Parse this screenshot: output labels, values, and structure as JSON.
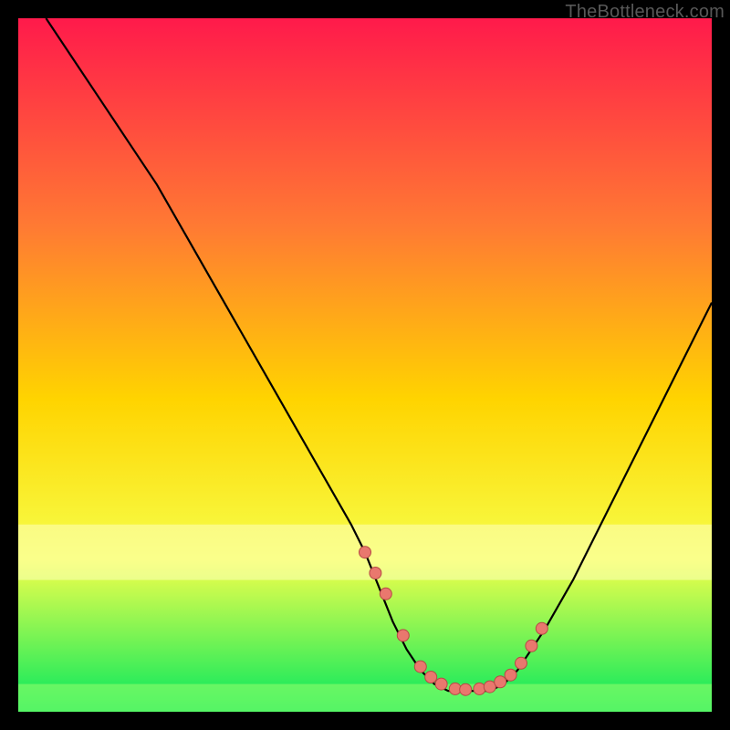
{
  "watermark": "TheBottleneck.com",
  "colors": {
    "bg": "#000000",
    "grad_top": "#ff1a4b",
    "grad_mid1": "#ff7a33",
    "grad_mid2": "#ffd400",
    "grad_mid3": "#f6ff4a",
    "grad_bottom": "#00e85e",
    "line": "#000000",
    "band_light": "#fdffc0",
    "band_green": "#9aff6b",
    "dot_fill": "#e9786e",
    "dot_stroke": "#b64a45"
  },
  "chart_data": {
    "type": "line",
    "title": "",
    "xlabel": "",
    "ylabel": "",
    "xlim": [
      0,
      100
    ],
    "ylim": [
      0,
      100
    ],
    "series": [
      {
        "name": "bottleneck-curve",
        "x": [
          4,
          8,
          12,
          16,
          20,
          24,
          28,
          32,
          36,
          40,
          44,
          48,
          50,
          52,
          54,
          56,
          58,
          60,
          62,
          64,
          66,
          68,
          70,
          72,
          76,
          80,
          84,
          88,
          92,
          96,
          100
        ],
        "y": [
          100,
          94,
          88,
          82,
          76,
          69,
          62,
          55,
          48,
          41,
          34,
          27,
          23,
          18,
          13,
          9,
          6,
          4,
          3,
          3,
          3,
          3,
          4,
          6,
          12,
          19,
          27,
          35,
          43,
          51,
          59
        ]
      }
    ],
    "dots": {
      "name": "highlighted-points",
      "x": [
        50,
        51.5,
        53,
        55.5,
        58,
        59.5,
        61,
        63,
        64.5,
        66.5,
        68,
        69.5,
        71,
        72.5,
        74,
        75.5
      ],
      "y": [
        23,
        20,
        17,
        11,
        6.5,
        5,
        4,
        3.3,
        3.2,
        3.3,
        3.6,
        4.3,
        5.3,
        7,
        9.5,
        12
      ]
    },
    "bands": [
      {
        "name": "light-band",
        "y0": 19,
        "y1": 27,
        "color_key": "band_light"
      },
      {
        "name": "green-band",
        "y0": 0,
        "y1": 4,
        "color_key": "band_green"
      }
    ]
  }
}
